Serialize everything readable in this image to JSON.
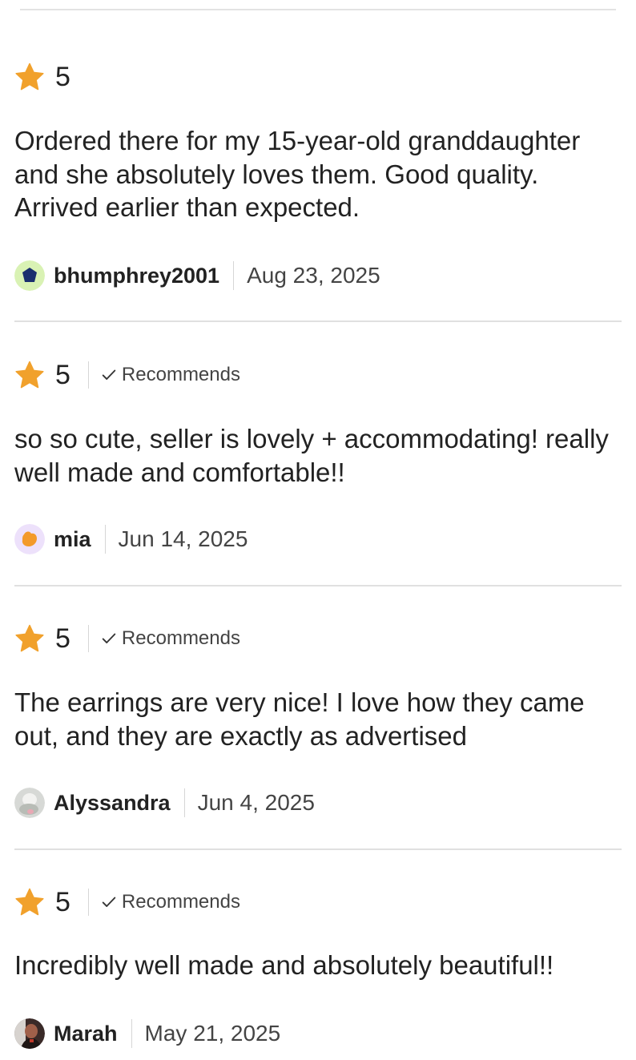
{
  "star_color": "#f1a12c",
  "reviews": [
    {
      "rating": "5",
      "recommends": "",
      "text": "Ordered there for my 15-year-old granddaughter and she absolutely loves them. Good quality. Arrived earlier than expected.",
      "author": "bhumphrey2001",
      "date": "Aug 23, 2025",
      "avatar_icon": "navy-pentagon-avatar"
    },
    {
      "rating": "5",
      "recommends": "Recommends",
      "text": "so so cute, seller is lovely + accommodating! really well made and comfortable!!",
      "author": "mia",
      "date": "Jun 14, 2025",
      "avatar_icon": "orange-blob-avatar"
    },
    {
      "rating": "5",
      "recommends": "Recommends",
      "text": "The earrings are very nice! I love how they came out, and they are exactly as advertised",
      "author": "Alyssandra",
      "date": "Jun 4, 2025",
      "avatar_icon": "photo-avatar"
    },
    {
      "rating": "5",
      "recommends": "Recommends",
      "text": "Incredibly well made and absolutely beautiful!!",
      "author": "Marah",
      "date": "May 21, 2025",
      "avatar_icon": "photo-avatar"
    }
  ]
}
